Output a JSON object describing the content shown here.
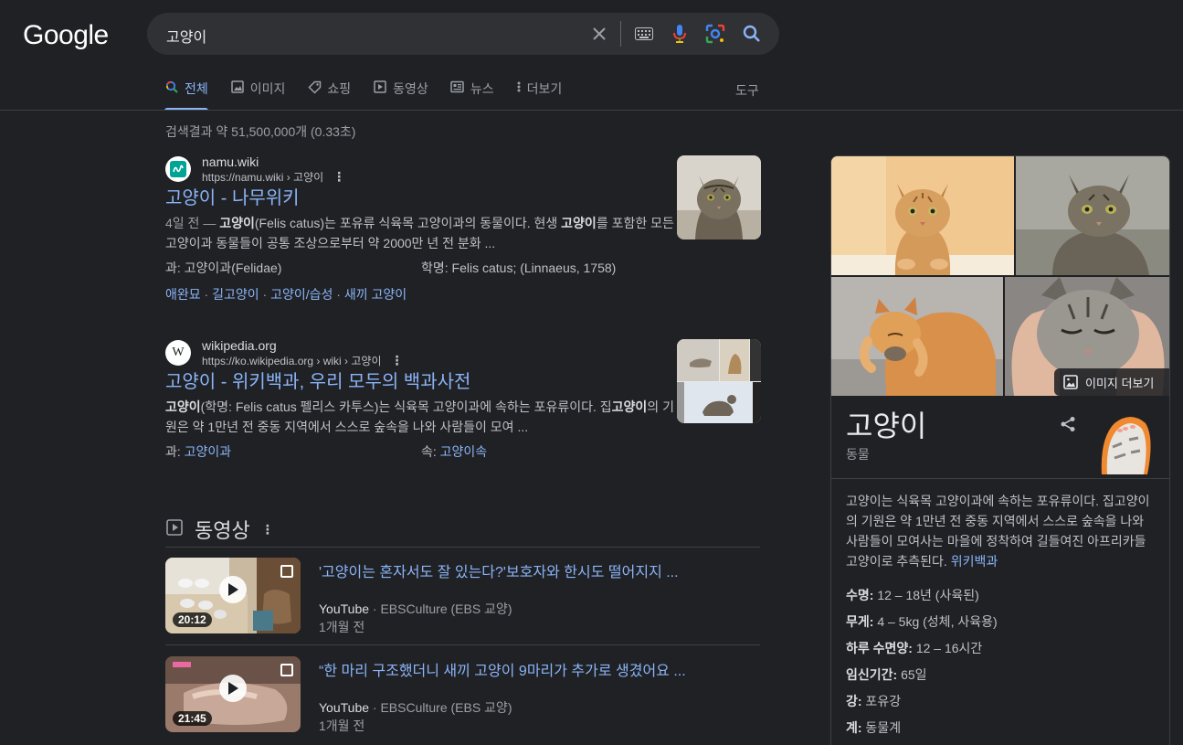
{
  "header": {
    "logo": "Google",
    "query": "고양이"
  },
  "tabs": [
    {
      "label": "전체",
      "icon": "search-icon",
      "active": true
    },
    {
      "label": "이미지",
      "icon": "image-icon"
    },
    {
      "label": "쇼핑",
      "icon": "tag-icon"
    },
    {
      "label": "동영상",
      "icon": "video-icon"
    },
    {
      "label": "뉴스",
      "icon": "news-icon"
    },
    {
      "label": "더보기",
      "icon": "more-vert-icon"
    }
  ],
  "tools_label": "도구",
  "stats": "검색결과 약 51,500,000개 (0.33초)",
  "results": [
    {
      "site": "namu.wiki",
      "url": "https://namu.wiki › 고양이",
      "title": "고양이 - 나무위키",
      "date": "4일 전 — ",
      "snippet_parts": [
        "고양이",
        "(Felis catus)는 포유류 식육목 고양이과의 동물이다. 현생 ",
        "고양이",
        "를 포함한 모든 고양이과 동물들이 공통 조상으로부터 약 2000만 년 전 분화 ..."
      ],
      "fact1_key": "과: ",
      "fact1_val": "고양이과(Felidae)",
      "fact2_key": "학명: ",
      "fact2_val": "Felis catus; (Linnaeus, 1758)",
      "sitelinks": [
        "애완묘",
        "길고양이",
        "고양이/습성",
        "새끼 고양이"
      ]
    },
    {
      "site": "wikipedia.org",
      "url": "https://ko.wikipedia.org › wiki › 고양이",
      "title": "고양이 - 위키백과, 우리 모두의 백과사전",
      "snippet_parts": [
        "고양이",
        "(학명: Felis catus 펠리스 카투스)는 식육목 고양이과에 속하는 포유류이다. 집",
        "고양이",
        "의 기원은 약 1만년 전 중동 지역에서 스스로 숲속을 나와 사람들이 모여 ..."
      ],
      "fact1_key": "과: ",
      "fact1_val": "고양이과",
      "fact2_key": "속: ",
      "fact2_val": "고양이속"
    }
  ],
  "videos_section": {
    "heading": "동영상",
    "items": [
      {
        "title": "'고양이는 혼자서도 잘 있는다?'보호자와 한시도 떨어지지 ...",
        "source": "YouTube",
        "channel": " · EBSCulture (EBS 교양)",
        "age": "1개월 전",
        "duration": "20:12"
      },
      {
        "title": "“한 마리 구조했더니 새끼 고양이 9마리가 추가로 생겼어요 ...",
        "source": "YouTube",
        "channel": " · EBSCulture (EBS 교양)",
        "age": "1개월 전",
        "duration": "21:45"
      }
    ]
  },
  "knowledge_panel": {
    "more_images": "이미지 더보기",
    "title": "고양이",
    "subtitle": "동물",
    "description": "고양이는 식육목 고양이과에 속하는 포유류이다. 집고양이의 기원은 약 1만년 전 중동 지역에서 스스로 숲속을 나와 사람들이 모여사는 마을에 정착하여 길들여진 아프리카들고양이로 추측된다. ",
    "description_link": "위키백과",
    "facts": [
      {
        "key": "수명:",
        "value": " 12 – 18년 (사육된)"
      },
      {
        "key": "무게:",
        "value": " 4 – 5kg (성체, 사육용)"
      },
      {
        "key": "하루 수면양:",
        "value": " 12 – 16시간"
      },
      {
        "key": "임신기간:",
        "value": " 65일"
      },
      {
        "key": "강:",
        "value": " 포유강"
      },
      {
        "key": "계:",
        "value": " 동물계"
      }
    ]
  },
  "colors": {
    "background": "#202124",
    "link": "#8ab4f8",
    "search_box": "#303134"
  }
}
